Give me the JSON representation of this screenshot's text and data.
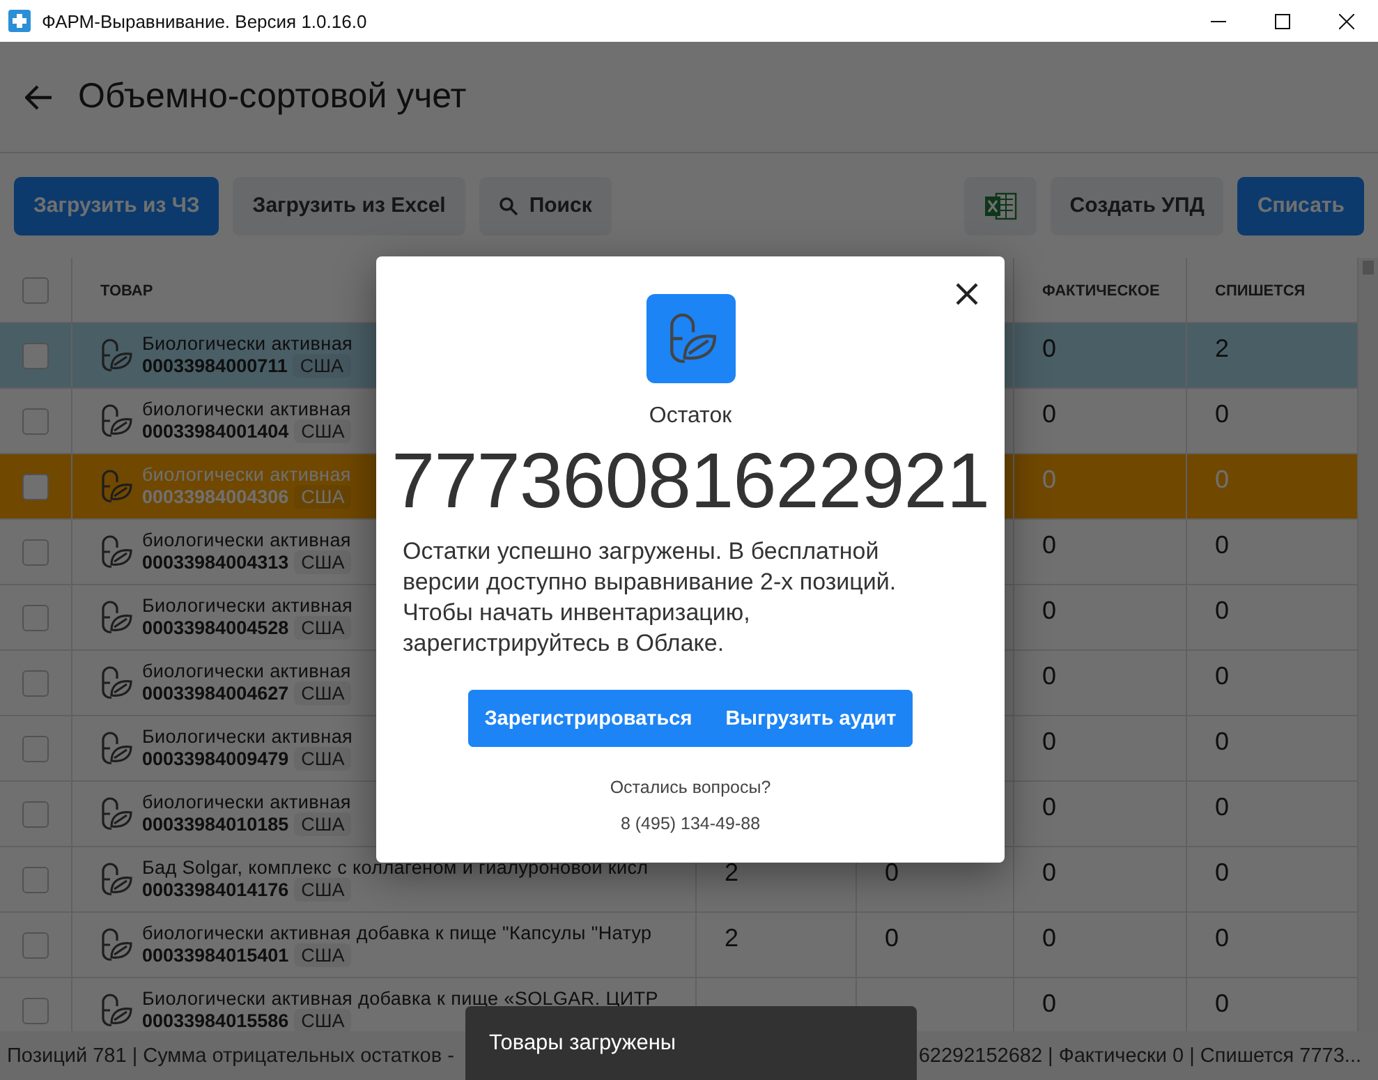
{
  "window": {
    "title": "ФАРМ-Выравнивание. Версия 1.0.16.0"
  },
  "header": {
    "title": "Объемно-сортовой учет"
  },
  "toolbar": {
    "left": [
      {
        "label": "Загрузить из ЧЗ",
        "kind": "primary"
      },
      {
        "label": "Загрузить из Excel",
        "kind": "secondary"
      },
      {
        "label": "Поиск",
        "kind": "search"
      }
    ],
    "right": [
      {
        "kind": "excel"
      },
      {
        "label": "Создать УПД",
        "kind": "secondary"
      },
      {
        "label": "Списать",
        "kind": "primary"
      }
    ]
  },
  "table": {
    "select_all": {
      "checked": false
    },
    "columns": [
      "ТОВАР",
      "",
      "",
      "ФАКТИЧЕСКОЕ",
      "СПИШЕТСЯ"
    ],
    "rows": [
      {
        "checked": false,
        "selected": true,
        "warning": false,
        "name": "Биологически активная",
        "code": "00033984000711",
        "country": "США",
        "actual": "0",
        "write_off": "2"
      },
      {
        "checked": false,
        "selected": false,
        "warning": false,
        "name": "биологически активная",
        "code": "00033984001404",
        "country": "США",
        "actual": "0",
        "write_off": "0"
      },
      {
        "checked": false,
        "selected": false,
        "warning": true,
        "name": "биологически активная",
        "code": "00033984004306",
        "country": "США",
        "actual": "0",
        "write_off": "0"
      },
      {
        "checked": false,
        "selected": false,
        "warning": false,
        "name": "биологически активная",
        "code": "00033984004313",
        "country": "США",
        "actual": "0",
        "write_off": "0"
      },
      {
        "checked": false,
        "selected": false,
        "warning": false,
        "name": "Биологически активная",
        "code": "00033984004528",
        "country": "США",
        "actual": "0",
        "write_off": "0"
      },
      {
        "checked": false,
        "selected": false,
        "warning": false,
        "name": "биологически активная",
        "code": "00033984004627",
        "country": "США",
        "actual": "0",
        "write_off": "0"
      },
      {
        "checked": false,
        "selected": false,
        "warning": false,
        "name": "Биологически активная",
        "code": "00033984009479",
        "country": "США",
        "actual": "0",
        "write_off": "0"
      },
      {
        "checked": false,
        "selected": false,
        "warning": false,
        "name": "биологически активная",
        "code": "00033984010185",
        "country": "США",
        "actual": "0",
        "write_off": "0"
      },
      {
        "checked": false,
        "selected": false,
        "warning": false,
        "name": "Бад Solgar, комплекс с коллагеном и гиалуроновой кисл",
        "code": "00033984014176",
        "country": "США",
        "column_2": "2",
        "column_3": "0",
        "actual": "0",
        "write_off": "0"
      },
      {
        "checked": false,
        "selected": false,
        "warning": false,
        "name": "биологически активная добавка к пище \"Капсулы \"Натур",
        "code": "00033984015401",
        "country": "США",
        "column_2": "2",
        "column_3": "0",
        "actual": "0",
        "write_off": "0"
      },
      {
        "checked": false,
        "selected": false,
        "warning": false,
        "name": "Биологически активная добавка к пище «SOLGAR. ЦИТР",
        "code": "00033984015586",
        "country": "США",
        "actual": "0",
        "write_off": "0"
      }
    ]
  },
  "status_bar": {
    "left": "Позиций 781 | Сумма отрицательных остатков -",
    "right": "62292152682 | Фактически 0 | Спишется 7773..."
  },
  "dialog": {
    "label": "Остаток",
    "value": "77736081622921",
    "message": "Остатки успешно загружены. В бесплатной версии доступно выравнивание 2-х позиций. Чтобы начать инвентаризацию, зарегистрируйтесь в Облаке.",
    "buttons": [
      "Зарегистрироваться",
      "Выгрузить аудит"
    ],
    "question": "Остались вопросы?",
    "phone": "8 (495) 134-49-88"
  },
  "toast": {
    "text": "Товары загружены"
  }
}
